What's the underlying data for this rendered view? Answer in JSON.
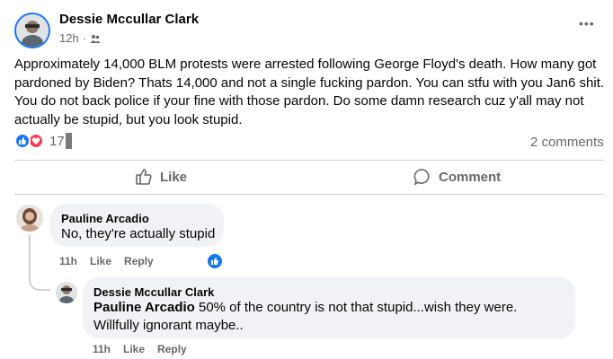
{
  "post": {
    "author": "Dessie Mccullar Clark",
    "time": "12h",
    "audience_icon": "friends-icon",
    "more_label": "•••",
    "text": "Approximately 14,000 BLM protests were arrested following George Floyd's death.  How many got pardoned by Biden? Thats 14,000 and not a single fucking pardon. You can stfu with you Jan6 shit. You do not back police if your fine with those pardon.  Do some damn research cuz y'all may not actually be stupid, but you look stupid.",
    "reaction_count": "17",
    "reactions": [
      "like-reaction-icon",
      "love-reaction-icon"
    ],
    "comments_count": "2 comments",
    "colors": {
      "like_blue": "#1877f2",
      "love_red": "#f33e58"
    }
  },
  "actions": {
    "like_label": "Like",
    "comment_label": "Comment"
  },
  "comments": [
    {
      "author": "Pauline Arcadio",
      "text": "No, they're actually stupid",
      "time": "11h",
      "like": "Like",
      "reply": "Reply"
    },
    {
      "author": "Dessie Mccullar Clark",
      "mention": "Pauline Arcadio",
      "text": " 50% of the country is not that stupid...wish they were. Willfully ignorant maybe..",
      "time": "11h",
      "like": "Like",
      "reply": "Reply"
    }
  ]
}
